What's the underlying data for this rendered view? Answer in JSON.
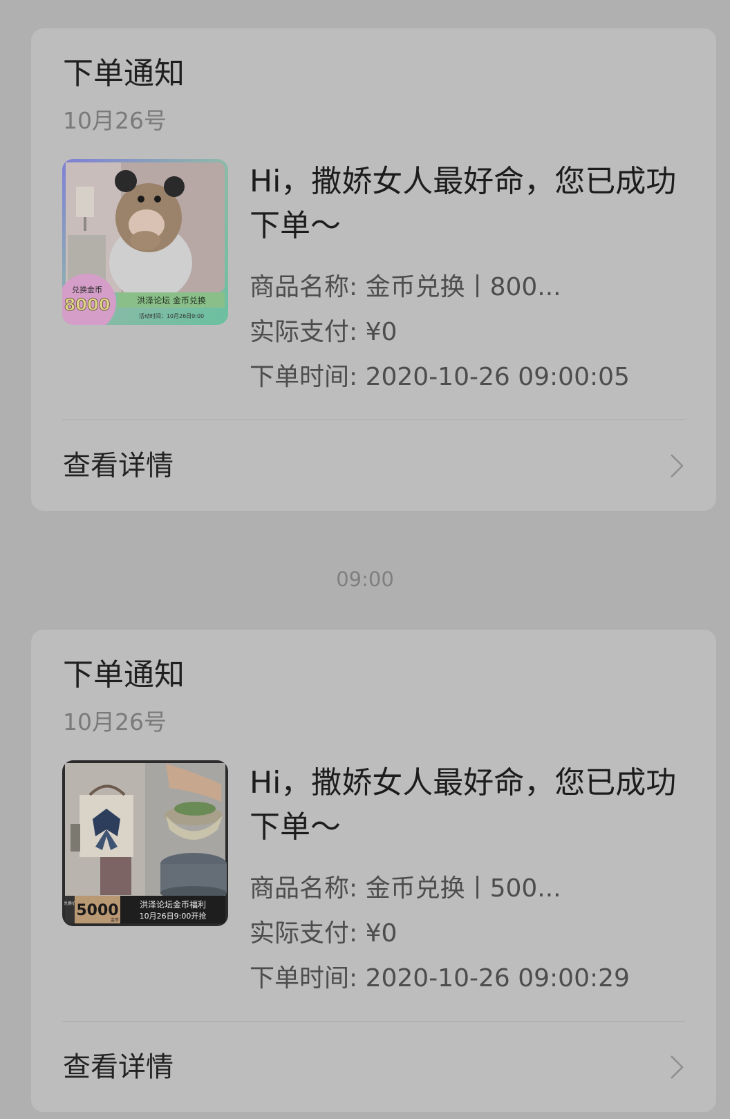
{
  "time_separator": "09:00",
  "notifications": [
    {
      "title": "下单通知",
      "date": "10月26号",
      "message": "Hi，撒娇女人最好命，您已成功下单～",
      "product_label": "商品名称: ",
      "product_value": "金币兑换丨800...",
      "paid_label": "实际支付: ",
      "paid_value": "¥0",
      "time_label": "下单时间: ",
      "time_value": "2020-10-26 09:00:05",
      "view_label": "查看详情",
      "thumb": {
        "badge_top": "兑换金币",
        "badge_value": "8000",
        "banner": "洪泽论坛 金币兑换",
        "sub": "活动时间：10月26日9:00"
      }
    },
    {
      "title": "下单通知",
      "date": "10月26号",
      "message": "Hi，撒娇女人最好命，您已成功下单～",
      "product_label": "商品名称: ",
      "product_value": "金币兑换丨500...",
      "paid_label": "实际支付: ",
      "paid_value": "¥0",
      "time_label": "下单时间: ",
      "time_value": "2020-10-26 09:00:29",
      "view_label": "查看详情",
      "thumb": {
        "badge_top": "兑换价",
        "badge_value": "5000",
        "badge_unit": "金币",
        "banner": "洪泽论坛金币福利",
        "sub": "10月26日9:00开抢"
      }
    }
  ]
}
